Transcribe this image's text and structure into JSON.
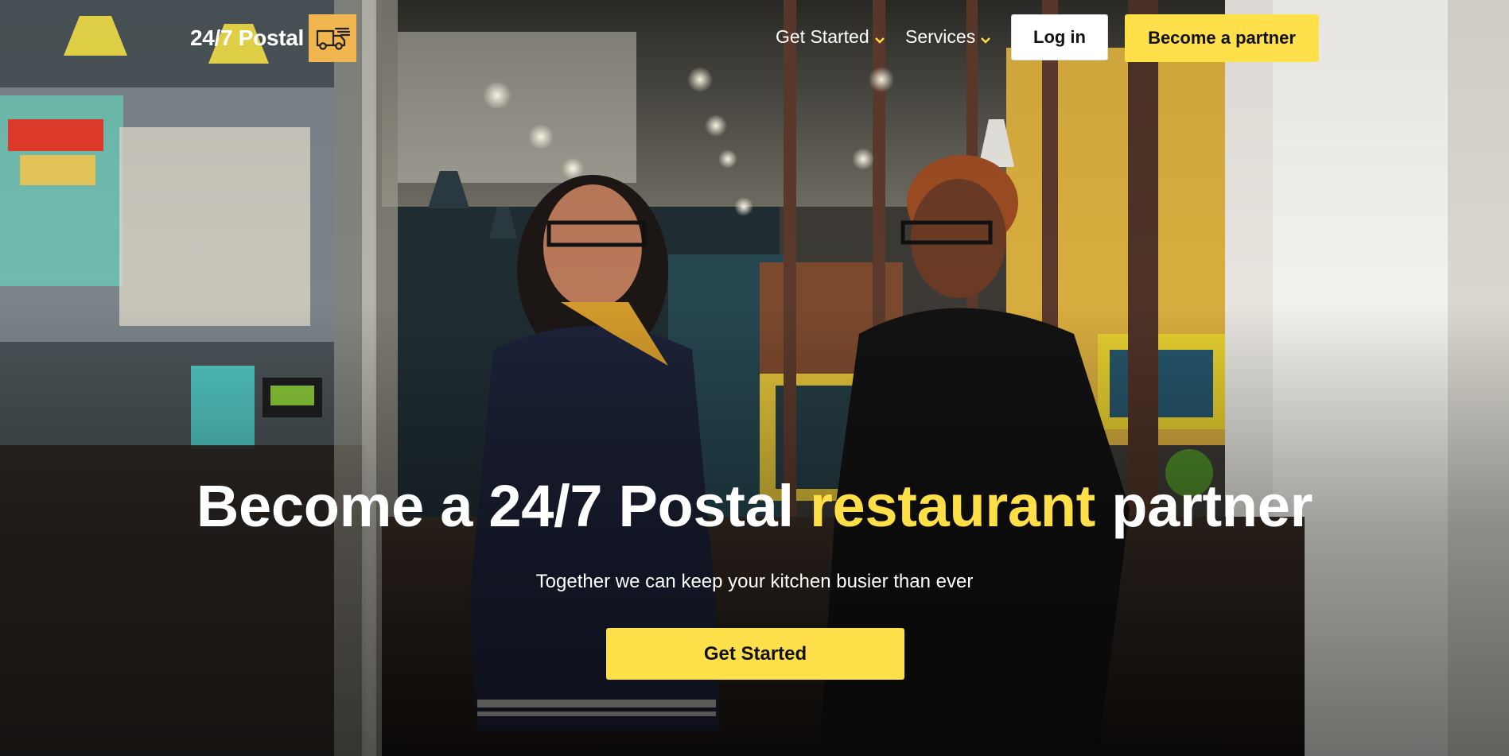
{
  "brand": {
    "name": "24/7 Postal",
    "logo_icon": "delivery-truck-icon",
    "accent_color": "#ffe04b",
    "logo_bg_color": "#f2b650"
  },
  "nav": {
    "items": [
      {
        "label": "Get Started",
        "icon": "chevron-down-icon"
      },
      {
        "label": "Services",
        "icon": "chevron-down-icon"
      }
    ],
    "login_label": "Log in",
    "partner_label": "Become a partner"
  },
  "hero": {
    "headline_pre": "Become a 24/7 Postal ",
    "headline_accent": "restaurant",
    "headline_post": " partner",
    "subheadline": "Together we can keep your kitchen busier than ever",
    "cta_label": "Get Started",
    "background": "photo-two-women-smiling-in-restaurant"
  }
}
